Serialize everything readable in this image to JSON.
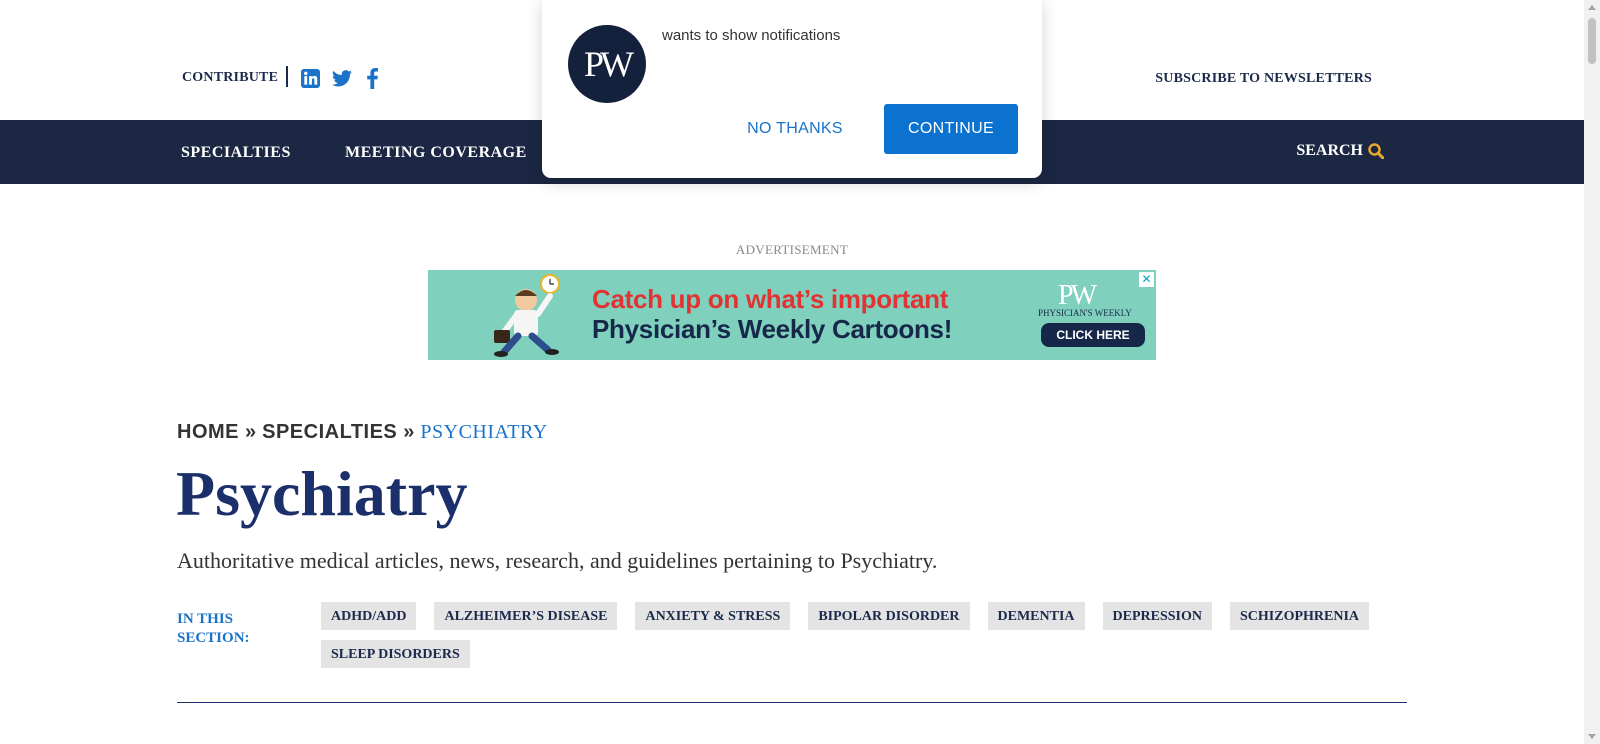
{
  "header": {
    "contribute_label": "CONTRIBUTE",
    "social_icons": [
      "linkedin-icon",
      "twitter-icon",
      "facebook-icon"
    ],
    "subscribe_label": "SUBSCRIBE TO NEWSLETTERS"
  },
  "nav": {
    "items": [
      {
        "label": "SPECIALTIES"
      },
      {
        "label": "MEETING COVERAGE"
      }
    ],
    "search_label": "SEARCH",
    "search_icon": "search-icon"
  },
  "ad": {
    "label": "ADVERTISEMENT",
    "headline": "Catch up on what’s important",
    "subheadline": "Physician’s Weekly Cartoons!",
    "brand": "PW",
    "brand_sub": "PHYSICIAN'S WEEKLY",
    "cta": "CLICK HERE",
    "close": "✕"
  },
  "breadcrumb": {
    "home": "HOME",
    "sep": "»",
    "specialties": "SPECIALTIES",
    "current": "PSYCHIATRY"
  },
  "page": {
    "title": "Psychiatry",
    "description": "Authoritative medical articles, news, research, and guidelines pertaining to Psychiatry.",
    "section_label": "IN THIS SECTION:",
    "tags": [
      "ADHD/ADD",
      "ALZHEIMER’S DISEASE",
      "ANXIETY & STRESS",
      "BIPOLAR DISORDER",
      "DEMENTIA",
      "DEPRESSION",
      "SCHIZOPHRENIA",
      "SLEEP DISORDERS"
    ]
  },
  "popup": {
    "logo_text": "PW",
    "message": "wants to show notifications",
    "no_thanks": "NO THANKS",
    "continue": "CONTINUE"
  },
  "colors": {
    "navy": "#1b2743",
    "title_blue": "#1b2f6b",
    "link_blue": "#1a73c8",
    "accent_gold": "#e8a92b",
    "ad_teal": "#7fd0bc",
    "ad_red": "#e23334",
    "button_blue": "#0b72d0"
  }
}
